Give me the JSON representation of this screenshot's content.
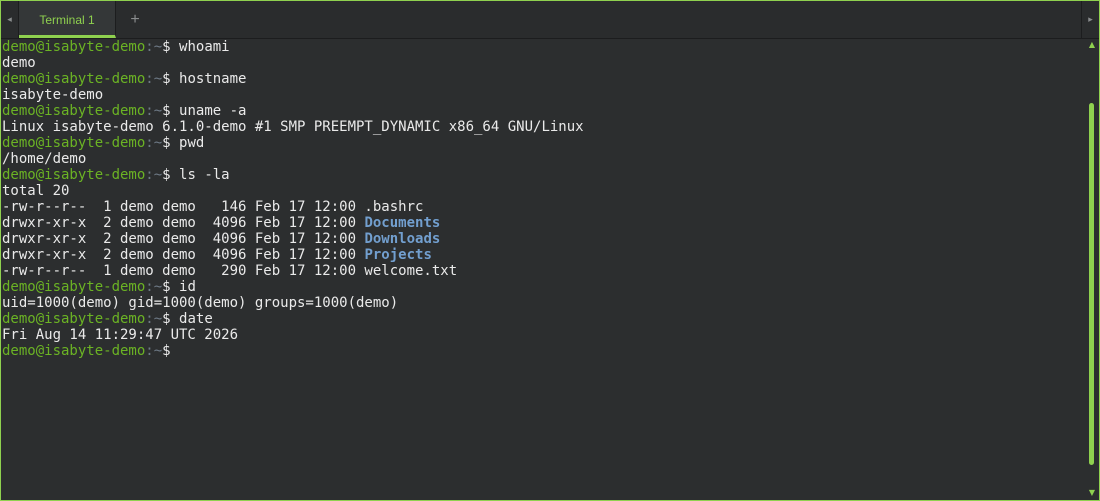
{
  "tabs": {
    "active_label": "Terminal 1",
    "new_tab_label": "+",
    "scroll_left": "◂",
    "scroll_right": "▸"
  },
  "prompt": {
    "user_host": "demo@isabyte-demo",
    "path": ":~",
    "symbol": "$"
  },
  "session": [
    {
      "cmd": "whoami",
      "output": [
        "demo"
      ]
    },
    {
      "cmd": "hostname",
      "output": [
        "isabyte-demo"
      ]
    },
    {
      "cmd": "uname -a",
      "output": [
        "Linux isabyte-demo 6.1.0-demo #1 SMP PREEMPT_DYNAMIC x86_64 GNU/Linux"
      ]
    },
    {
      "cmd": "pwd",
      "output": [
        "/home/demo"
      ]
    },
    {
      "cmd": "ls -la",
      "output": [
        "total 20",
        "-rw-r--r--  1 demo demo   146 Feb 17 12:00 .bashrc",
        "drwxr-xr-x  2 demo demo  4096 Feb 17 12:00 Documents",
        "drwxr-xr-x  2 demo demo  4096 Feb 17 12:00 Downloads",
        "drwxr-xr-x  2 demo demo  4096 Feb 17 12:00 Projects",
        "-rw-r--r--  1 demo demo   290 Feb 17 12:00 welcome.txt"
      ]
    },
    {
      "cmd": "id",
      "output": [
        "uid=1000(demo) gid=1000(demo) groups=1000(demo)"
      ]
    },
    {
      "cmd": "date",
      "output": [
        "Fri Aug 14 11:29:47 UTC 2026"
      ]
    },
    {
      "cmd": "",
      "output": []
    }
  ],
  "ls_listing": {
    "prefixes": [
      "drwxr-xr-x  2 demo demo  4096 Feb 17 12:00 ",
      "drwxr-xr-x  2 demo demo  4096 Feb 17 12:00 ",
      "drwxr-xr-x  2 demo demo  4096 Feb 17 12:00 "
    ],
    "directories": [
      "Documents",
      "Downloads",
      "Projects"
    ]
  },
  "colors": {
    "accent": "#8fd14f",
    "prompt_user": "#6bb324",
    "directory": "#729fcf",
    "background": "#2c2e2f",
    "text": "#eaeaea"
  },
  "scroll": {
    "up_icon": "▲",
    "down_icon": "▼",
    "thumb_position_fraction": 0.12,
    "thumb_size_fraction": 0.83
  }
}
